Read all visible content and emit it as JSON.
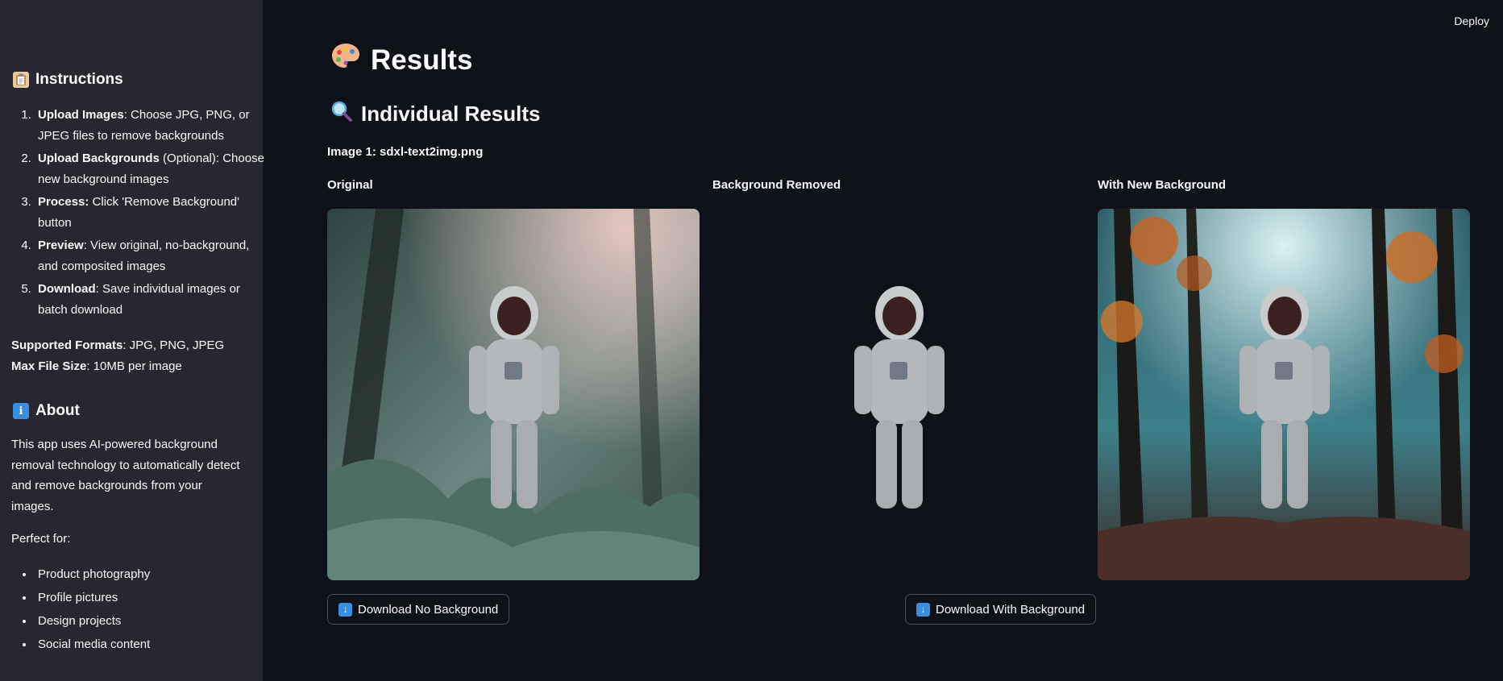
{
  "header": {
    "deploy_label": "Deploy"
  },
  "sidebar": {
    "instructions_title": "Instructions",
    "steps": [
      {
        "bold": "Upload Images",
        "text": ": Choose JPG, PNG, or JPEG files to remove backgrounds"
      },
      {
        "bold": "Upload Backgrounds",
        "text": " (Optional): Choose new background images"
      },
      {
        "bold": "Process:",
        "text": " Click 'Remove Background' button"
      },
      {
        "bold": "Preview",
        "text": ": View original, no-background, and composited images"
      },
      {
        "bold": "Download",
        "text": ": Save individual images or batch download"
      }
    ],
    "formats_bold": "Supported Formats",
    "formats_text": ": JPG, PNG, JPEG ",
    "maxsize_bold": "Max File Size",
    "maxsize_text": ": 10MB per image",
    "about_title": "About",
    "about_text": "This app uses AI-powered background removal technology to automatically detect and remove backgrounds from your images.",
    "perfect_for": "Perfect for:",
    "uses": [
      "Product photography",
      "Profile pictures",
      "Design projects",
      "Social media content"
    ]
  },
  "main": {
    "title": "Results",
    "subtitle": "Individual Results",
    "image_caption": "Image 1: sdxl-text2img.png",
    "columns": [
      "Original",
      "Background Removed",
      "With New Background"
    ],
    "download_no_bg": "Download No Background",
    "download_with_bg": "Download With Background"
  },
  "icons": {
    "title_icon": "palette-icon",
    "subtitle_icon": "magnifier-icon",
    "instructions_icon": "clipboard-icon",
    "about_icon": "info-icon",
    "download_icon": "down-arrow-icon"
  }
}
